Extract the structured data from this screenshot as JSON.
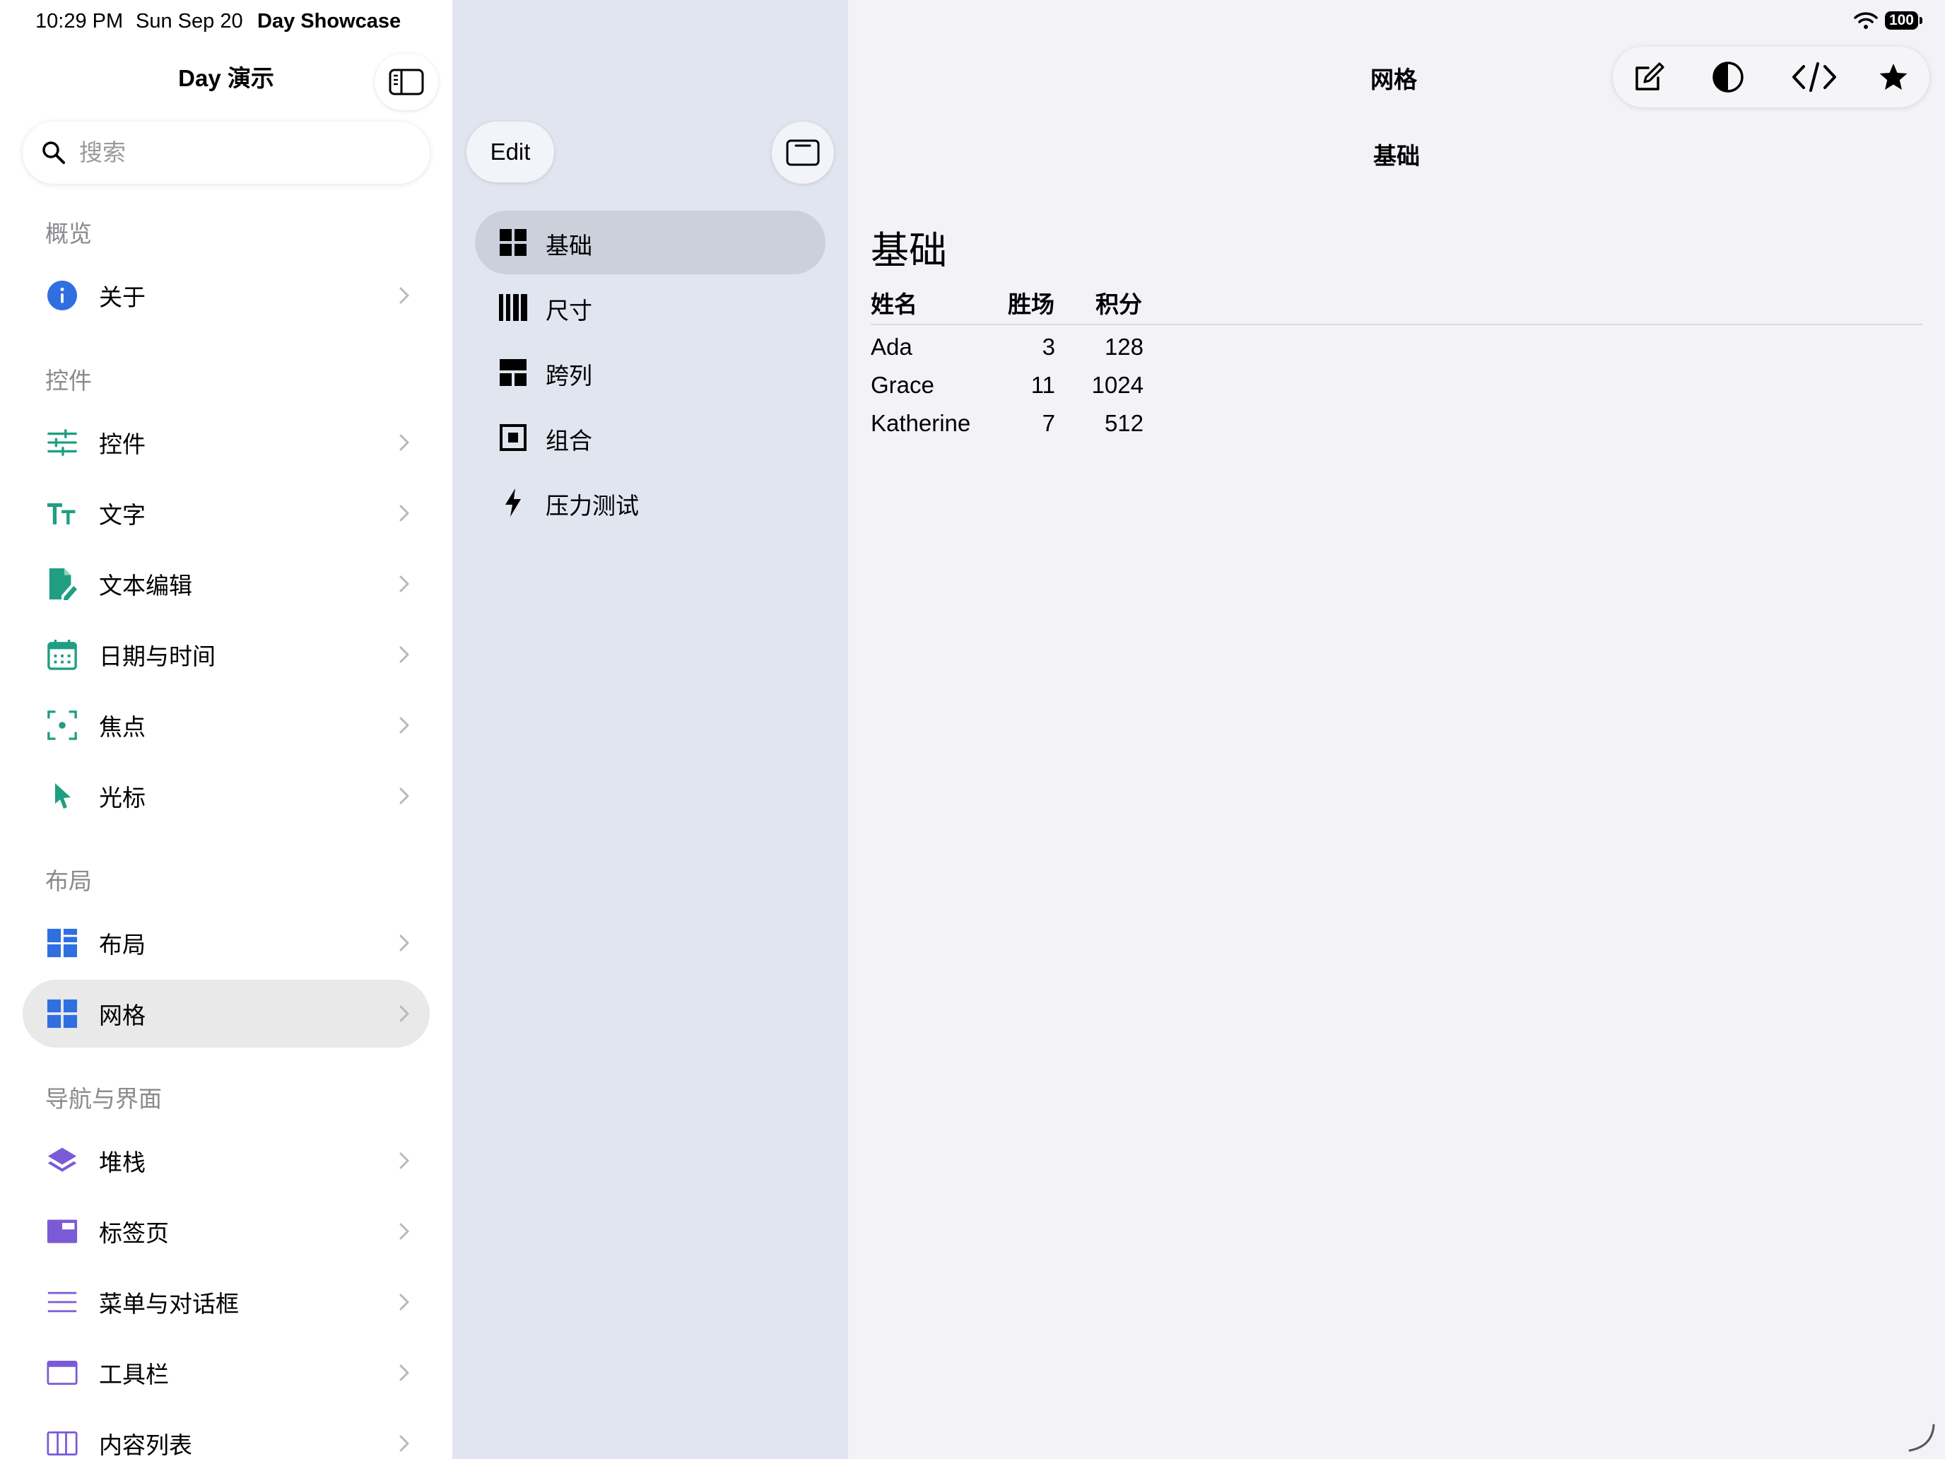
{
  "status_bar": {
    "time": "10:29 PM",
    "date": "Sun Sep 20",
    "app_name": "Day Showcase",
    "battery": "100"
  },
  "sidebar": {
    "title": "Day 演示",
    "search_placeholder": "搜索",
    "sections": [
      {
        "header": "概览",
        "items": [
          {
            "label": "关于",
            "icon": "info-circle-icon",
            "color": "#2f6fe0"
          }
        ]
      },
      {
        "header": "控件",
        "items": [
          {
            "label": "控件",
            "icon": "sliders-icon",
            "color": "#1f9e82"
          },
          {
            "label": "文字",
            "icon": "text-size-icon",
            "color": "#1f9e82"
          },
          {
            "label": "文本编辑",
            "icon": "document-edit-icon",
            "color": "#1f9e82"
          },
          {
            "label": "日期与时间",
            "icon": "calendar-icon",
            "color": "#1f9e82"
          },
          {
            "label": "焦点",
            "icon": "focus-icon",
            "color": "#1f9e82"
          },
          {
            "label": "光标",
            "icon": "cursor-icon",
            "color": "#1f9e82"
          }
        ]
      },
      {
        "header": "布局",
        "items": [
          {
            "label": "布局",
            "icon": "layout-grid-icon",
            "color": "#2f6fe0"
          },
          {
            "label": "网格",
            "icon": "grid-icon",
            "color": "#2f6fe0",
            "selected": true
          }
        ]
      },
      {
        "header": "导航与界面",
        "items": [
          {
            "label": "堆栈",
            "icon": "stack-layers-icon",
            "color": "#7b5ad6"
          },
          {
            "label": "标签页",
            "icon": "tabs-icon",
            "color": "#7b5ad6"
          },
          {
            "label": "菜单与对话框",
            "icon": "menu-lines-icon",
            "color": "#7b5ad6"
          },
          {
            "label": "工具栏",
            "icon": "toolbar-window-icon",
            "color": "#7b5ad6"
          },
          {
            "label": "内容列表",
            "icon": "content-list-icon",
            "color": "#7b5ad6"
          }
        ]
      }
    ]
  },
  "middle": {
    "edit_label": "Edit",
    "items": [
      {
        "label": "基础",
        "icon": "grid-four-icon",
        "selected": true
      },
      {
        "label": "尺寸",
        "icon": "columns-icon"
      },
      {
        "label": "跨列",
        "icon": "span-columns-icon"
      },
      {
        "label": "组合",
        "icon": "square-inset-icon"
      },
      {
        "label": "压力测试",
        "icon": "bolt-icon"
      }
    ]
  },
  "detail": {
    "nav_title": "网格",
    "subtitle": "基础",
    "heading": "基础",
    "toolbar": [
      {
        "name": "compose-icon"
      },
      {
        "name": "contrast-icon"
      },
      {
        "name": "code-icon"
      },
      {
        "name": "star-icon"
      }
    ],
    "table": {
      "headers": [
        "姓名",
        "胜场",
        "积分"
      ],
      "rows": [
        [
          "Ada",
          "3",
          "128"
        ],
        [
          "Grace",
          "11",
          "1024"
        ],
        [
          "Katherine",
          "7",
          "512"
        ]
      ]
    }
  },
  "colors": {
    "sidebar_bg": "#ffffff",
    "middle_bg": "#e1e5f0",
    "detail_bg": "#f2f2f7",
    "accent_green": "#1f9e82",
    "accent_blue": "#2f6fe0",
    "accent_purple": "#7b5ad6"
  }
}
